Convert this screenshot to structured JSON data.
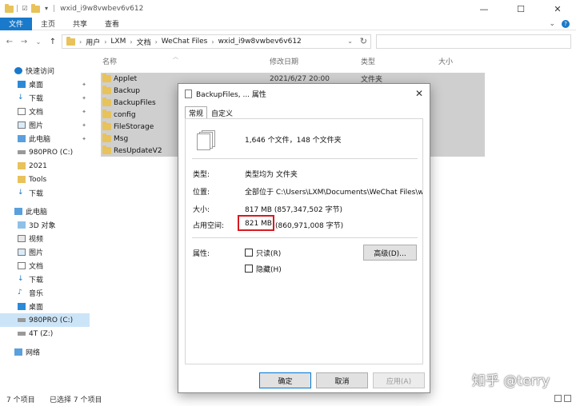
{
  "window": {
    "title": "wxid_i9w8vwbev6v612"
  },
  "ribbon": {
    "tabs": [
      "文件",
      "主页",
      "共享",
      "查看"
    ]
  },
  "address": {
    "crumbs": [
      "用户",
      "LXM",
      "文档",
      "WeChat Files",
      "wxid_i9w8vwbev6v612"
    ]
  },
  "sidebar": {
    "items": [
      {
        "label": "快速访问",
        "icon": "star-icon"
      },
      {
        "label": "桌面",
        "icon": "desktop-icon",
        "pinned": true
      },
      {
        "label": "下载",
        "icon": "download-icon",
        "pinned": true
      },
      {
        "label": "文档",
        "icon": "document-icon",
        "pinned": true
      },
      {
        "label": "图片",
        "icon": "picture-icon",
        "pinned": true
      },
      {
        "label": "此电脑",
        "icon": "computer-icon",
        "pinned": true
      },
      {
        "label": "980PRO (C:)",
        "icon": "drive-icon"
      },
      {
        "label": "2021",
        "icon": "folder-icon"
      },
      {
        "label": "Tools",
        "icon": "folder-icon"
      },
      {
        "label": "下载",
        "icon": "download-icon"
      },
      {
        "label": "此电脑",
        "icon": "computer-icon"
      },
      {
        "label": "3D 对象",
        "icon": "cube-icon"
      },
      {
        "label": "视频",
        "icon": "video-icon"
      },
      {
        "label": "图片",
        "icon": "picture-icon"
      },
      {
        "label": "文档",
        "icon": "document-icon"
      },
      {
        "label": "下载",
        "icon": "download-icon"
      },
      {
        "label": "音乐",
        "icon": "music-icon"
      },
      {
        "label": "桌面",
        "icon": "desktop-icon"
      },
      {
        "label": "980PRO (C:)",
        "icon": "drive-icon",
        "selected": true
      },
      {
        "label": "4T (Z:)",
        "icon": "drive-icon"
      },
      {
        "label": "网络",
        "icon": "network-icon"
      }
    ]
  },
  "columns": {
    "name": "名称",
    "modified": "修改日期",
    "type": "类型",
    "size": "大小"
  },
  "files": [
    {
      "name": "Applet",
      "modified": "2021/6/27 20:00",
      "type": "文件夹"
    },
    {
      "name": "Backup"
    },
    {
      "name": "BackupFiles"
    },
    {
      "name": "config"
    },
    {
      "name": "FileStorage"
    },
    {
      "name": "Msg"
    },
    {
      "name": "ResUpdateV2"
    }
  ],
  "dialog": {
    "title": "BackupFiles, ... 属性",
    "tabs": [
      "常规",
      "自定义"
    ],
    "summary": "1,646 个文件，148 个文件夹",
    "type_label": "类型:",
    "type_value": "类型均为 文件夹",
    "location_label": "位置:",
    "location_value": "全部位于 C:\\Users\\LXM\\Documents\\WeChat Files\\wxi",
    "size_label": "大小:",
    "size_value": "817 MB (857,347,502 字节)",
    "disk_label": "占用空间:",
    "disk_value_highlight": "821 MB",
    "disk_value_rest": "(860,971,008 字节)",
    "attr_label": "属性:",
    "readonly_label": "只读(R)",
    "hidden_label": "隐藏(H)",
    "advanced_button": "高级(D)...",
    "ok_button": "确定",
    "cancel_button": "取消",
    "apply_button": "应用(A)"
  },
  "status": {
    "count": "7 个项目",
    "selected": "已选择 7 个项目"
  },
  "watermark": "知乎 @terry",
  "colors": {
    "accent": "#1979ca",
    "selection": "#cfcfcf",
    "highlight_box": "#d71920"
  }
}
